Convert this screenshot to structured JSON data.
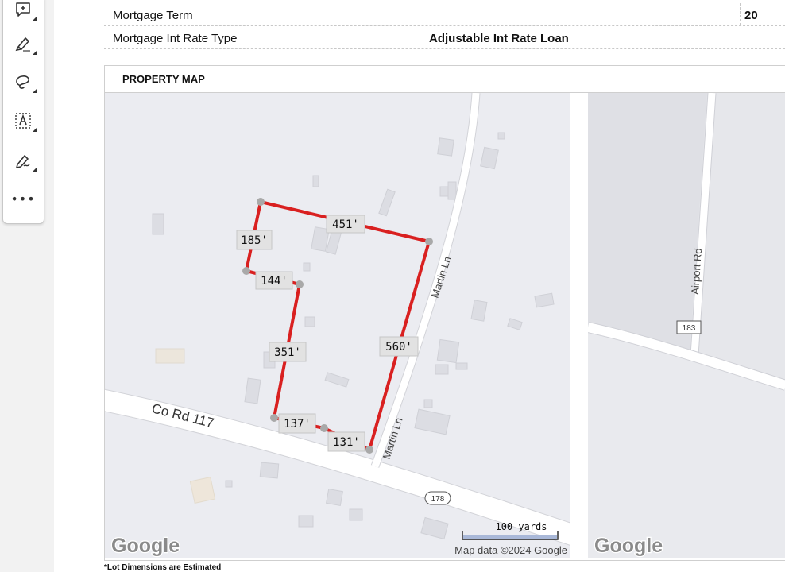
{
  "toolbar": {
    "tools": [
      {
        "icon": "add-comment-icon"
      },
      {
        "icon": "highlighter-icon"
      },
      {
        "icon": "freehand-lasso-icon"
      },
      {
        "icon": "text-box-icon"
      },
      {
        "icon": "draw-signature-icon"
      }
    ],
    "more_label": "•••"
  },
  "details": {
    "mortgage_term_label": "Mortgage Term",
    "mortgage_term_value": "20",
    "rate_type_label": "Mortgage Int Rate Type",
    "rate_type_value": "Adjustable Int Rate Loan"
  },
  "property_map": {
    "title": "PROPERTY MAP",
    "roads": {
      "co_rd": "Co Rd 117",
      "martin_ln": "Martin Ln",
      "airport_rd": "Airport Rd",
      "route_178": "178",
      "route_183": "183"
    },
    "dimensions": [
      "451'",
      "185'",
      "144'",
      "351'",
      "560'",
      "137'",
      "131'"
    ],
    "scale_label": "100 yards",
    "attribution": "Map data ©2024 Google",
    "logo_text": "Google",
    "boundary_color": "#d92020"
  },
  "footnote": "*Lot Dimensions are Estimated"
}
